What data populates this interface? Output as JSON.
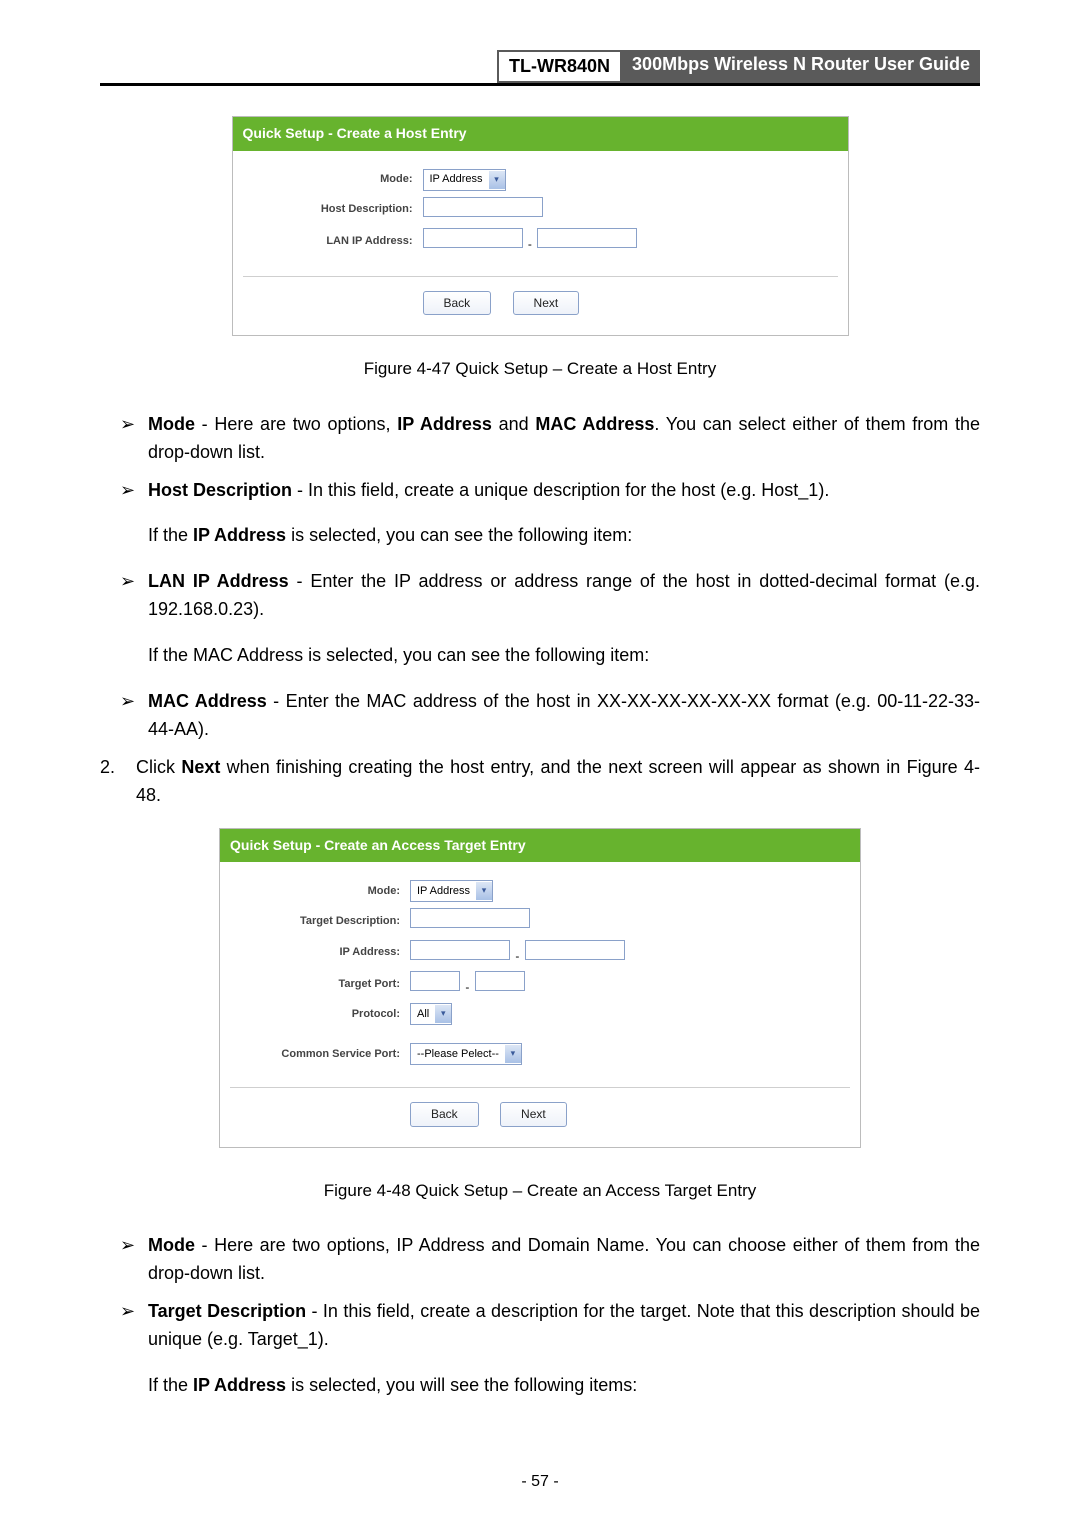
{
  "header": {
    "model": "TL-WR840N",
    "title": "300Mbps Wireless N Router User Guide"
  },
  "figure47": {
    "panel_title": "Quick Setup - Create a Host Entry",
    "labels": {
      "mode": "Mode:",
      "host_desc": "Host Description:",
      "lan_ip": "LAN IP Address:"
    },
    "mode_value": "IP Address",
    "range_sep": "-",
    "back": "Back",
    "next": "Next",
    "caption": "Figure 4-47    Quick Setup – Create a Host Entry"
  },
  "bullets1": {
    "mark": "➢",
    "mode_b": "Mode",
    "mode_t1": " - Here are two options, ",
    "mode_b2": "IP Address",
    "mode_t2": " and ",
    "mode_b3": "MAC Address",
    "mode_t3": ". You can select either of them from the drop-down list.",
    "hd_b": "Host Description",
    "hd_t": " - In this field, create a unique description for the host (e.g. Host_1).",
    "ip_sel_pre": "If the ",
    "ip_sel_b": "IP Address",
    "ip_sel_post": " is selected, you can see the following item:",
    "lan_b": "LAN IP Address",
    "lan_t": " - Enter the IP address or address range of the host in dotted-decimal format (e.g. 192.168.0.23).",
    "mac_para": "If the MAC Address is selected, you can see the following item:",
    "mac_b": "MAC Address",
    "mac_t": " - Enter the MAC address of the host in XX-XX-XX-XX-XX-XX format (e.g. 00-11-22-33-44-AA)."
  },
  "step2": {
    "num": "2.",
    "pre": "Click ",
    "b": "Next",
    "post": " when finishing creating the host entry, and the next screen will appear as shown in Figure 4-48."
  },
  "figure48": {
    "panel_title": "Quick Setup - Create an Access Target Entry",
    "labels": {
      "mode": "Mode:",
      "target_desc": "Target Description:",
      "ip": "IP Address:",
      "target_port": "Target Port:",
      "protocol": "Protocol:",
      "csp": "Common Service Port:"
    },
    "mode_value": "IP Address",
    "protocol_value": "All",
    "csp_value": "--Please Pelect--",
    "range_sep": "-",
    "back": "Back",
    "next": "Next",
    "caption": "Figure 4-48    Quick Setup – Create an Access Target Entry"
  },
  "bullets2": {
    "mark": "➢",
    "mode_b": "Mode",
    "mode_t": " - Here are two options, IP Address and Domain Name. You can choose either of them from the drop-down list.",
    "td_b": "Target Description",
    "td_t": " - In this field, create a description for the target. Note that this description should be unique (e.g. Target_1).",
    "ip_sel_pre": "If the ",
    "ip_sel_b": "IP Address",
    "ip_sel_post": " is selected, you will see the following items:"
  },
  "page_number": "- 57 -"
}
